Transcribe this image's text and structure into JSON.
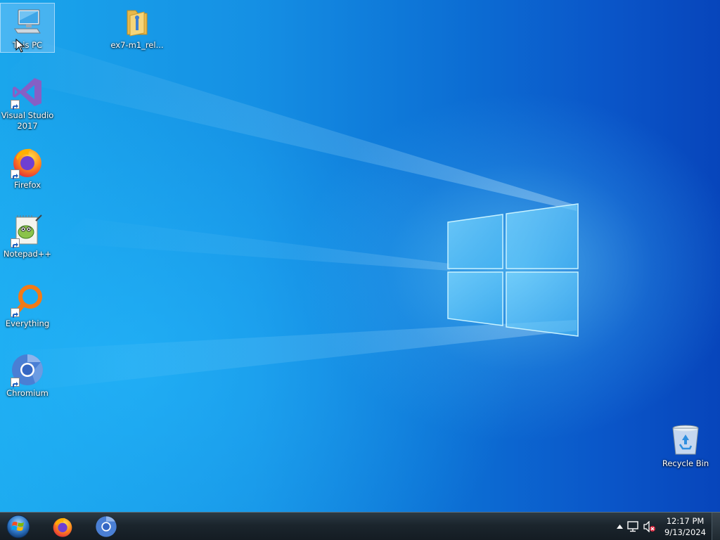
{
  "desktop": {
    "icons": [
      {
        "label": "This PC",
        "icon": "computer-icon"
      },
      {
        "label": "ex7-m1_rel...",
        "icon": "folder-icon"
      },
      {
        "label": "Visual Studio 2017",
        "icon": "visual-studio-icon"
      },
      {
        "label": "Firefox",
        "icon": "firefox-icon"
      },
      {
        "label": "Notepad++",
        "icon": "notepad-plus-plus-icon"
      },
      {
        "label": "Everything",
        "icon": "everything-search-icon"
      },
      {
        "label": "Chromium",
        "icon": "chromium-icon"
      },
      {
        "label": "Recycle Bin",
        "icon": "recycle-bin-icon"
      }
    ],
    "selected_icon": "This PC"
  },
  "taskbar": {
    "start_icon": "windows-start-orb-icon",
    "pinned": [
      {
        "name": "Firefox",
        "icon": "firefox-icon"
      },
      {
        "name": "Chromium",
        "icon": "chromium-icon"
      }
    ],
    "tray": {
      "icons": [
        "show-hidden-icons-arrow-icon",
        "network-icon",
        "volume-muted-icon"
      ],
      "time": "12:17 PM",
      "date": "9/13/2024"
    }
  },
  "colors": {
    "desktop_blue": "#0d73d6",
    "taskbar": "#1b252d",
    "firefox_orange": "#ff7a1a",
    "vs_purple": "#865fc5",
    "everything_orange": "#f37a16",
    "chromium_blue": "#4a7fd4"
  }
}
